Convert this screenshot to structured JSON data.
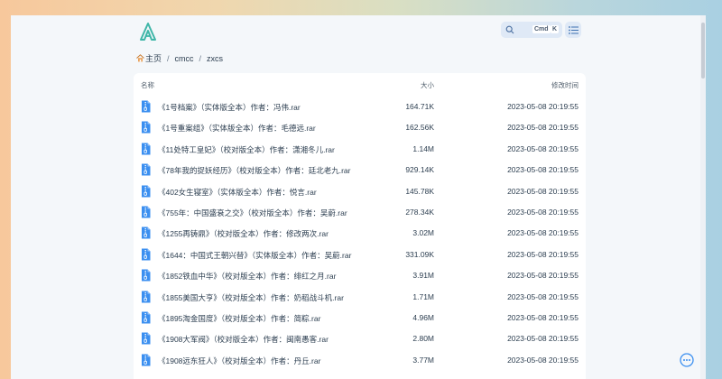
{
  "search": {
    "kbd_cmd": "Cmd",
    "kbd_k": "K"
  },
  "breadcrumb": {
    "home": "主页",
    "items": [
      "cmcc",
      "zxcs"
    ]
  },
  "table": {
    "headers": {
      "name": "名称",
      "size": "大小",
      "modified": "修改时间"
    },
    "rows": [
      {
        "name": "《1号档案》（实体版全本）作者：冯伟.rar",
        "size": "164.71K",
        "modified": "2023-05-08 20:19:55"
      },
      {
        "name": "《1号重案组》（实体版全本）作者：毛德远.rar",
        "size": "162.56K",
        "modified": "2023-05-08 20:19:55"
      },
      {
        "name": "《11处特工皇妃》（校对版全本）作者：潇湘冬儿.rar",
        "size": "1.14M",
        "modified": "2023-05-08 20:19:55"
      },
      {
        "name": "《78年我的捉妖经历》（校对版全本）作者：廷北老九.rar",
        "size": "929.14K",
        "modified": "2023-05-08 20:19:55"
      },
      {
        "name": "《402女生寝室》（实体版全本）作者：悦言.rar",
        "size": "145.78K",
        "modified": "2023-05-08 20:19:55"
      },
      {
        "name": "《755年：中国盛衰之交》（校对版全本）作者：吴蔚.rar",
        "size": "278.34K",
        "modified": "2023-05-08 20:19:55"
      },
      {
        "name": "《1255再铸鼎》（校对版全本）作者：修改两次.rar",
        "size": "3.02M",
        "modified": "2023-05-08 20:19:55"
      },
      {
        "name": "《1644：中国式王朝兴替》（实体版全本）作者：吴蔚.rar",
        "size": "331.09K",
        "modified": "2023-05-08 20:19:55"
      },
      {
        "name": "《1852铁血中华》（校对版全本）作者：绯红之月.rar",
        "size": "3.91M",
        "modified": "2023-05-08 20:19:55"
      },
      {
        "name": "《1855美国大亨》（校对版全本）作者：奶稻战斗机.rar",
        "size": "1.71M",
        "modified": "2023-05-08 20:19:55"
      },
      {
        "name": "《1895淘金国度》（校对版全本）作者：简粽.rar",
        "size": "4.96M",
        "modified": "2023-05-08 20:19:55"
      },
      {
        "name": "《1908大军阀》（校对版全本）作者：闽南愚客.rar",
        "size": "2.80M",
        "modified": "2023-05-08 20:19:55"
      },
      {
        "name": "《1908远东狂人》（校对版全本）作者：丹丘.rar",
        "size": "3.77M",
        "modified": "2023-05-08 20:19:55"
      }
    ]
  },
  "colors": {
    "accent": "#3b8ff0",
    "logo": "#3fb6a8"
  }
}
